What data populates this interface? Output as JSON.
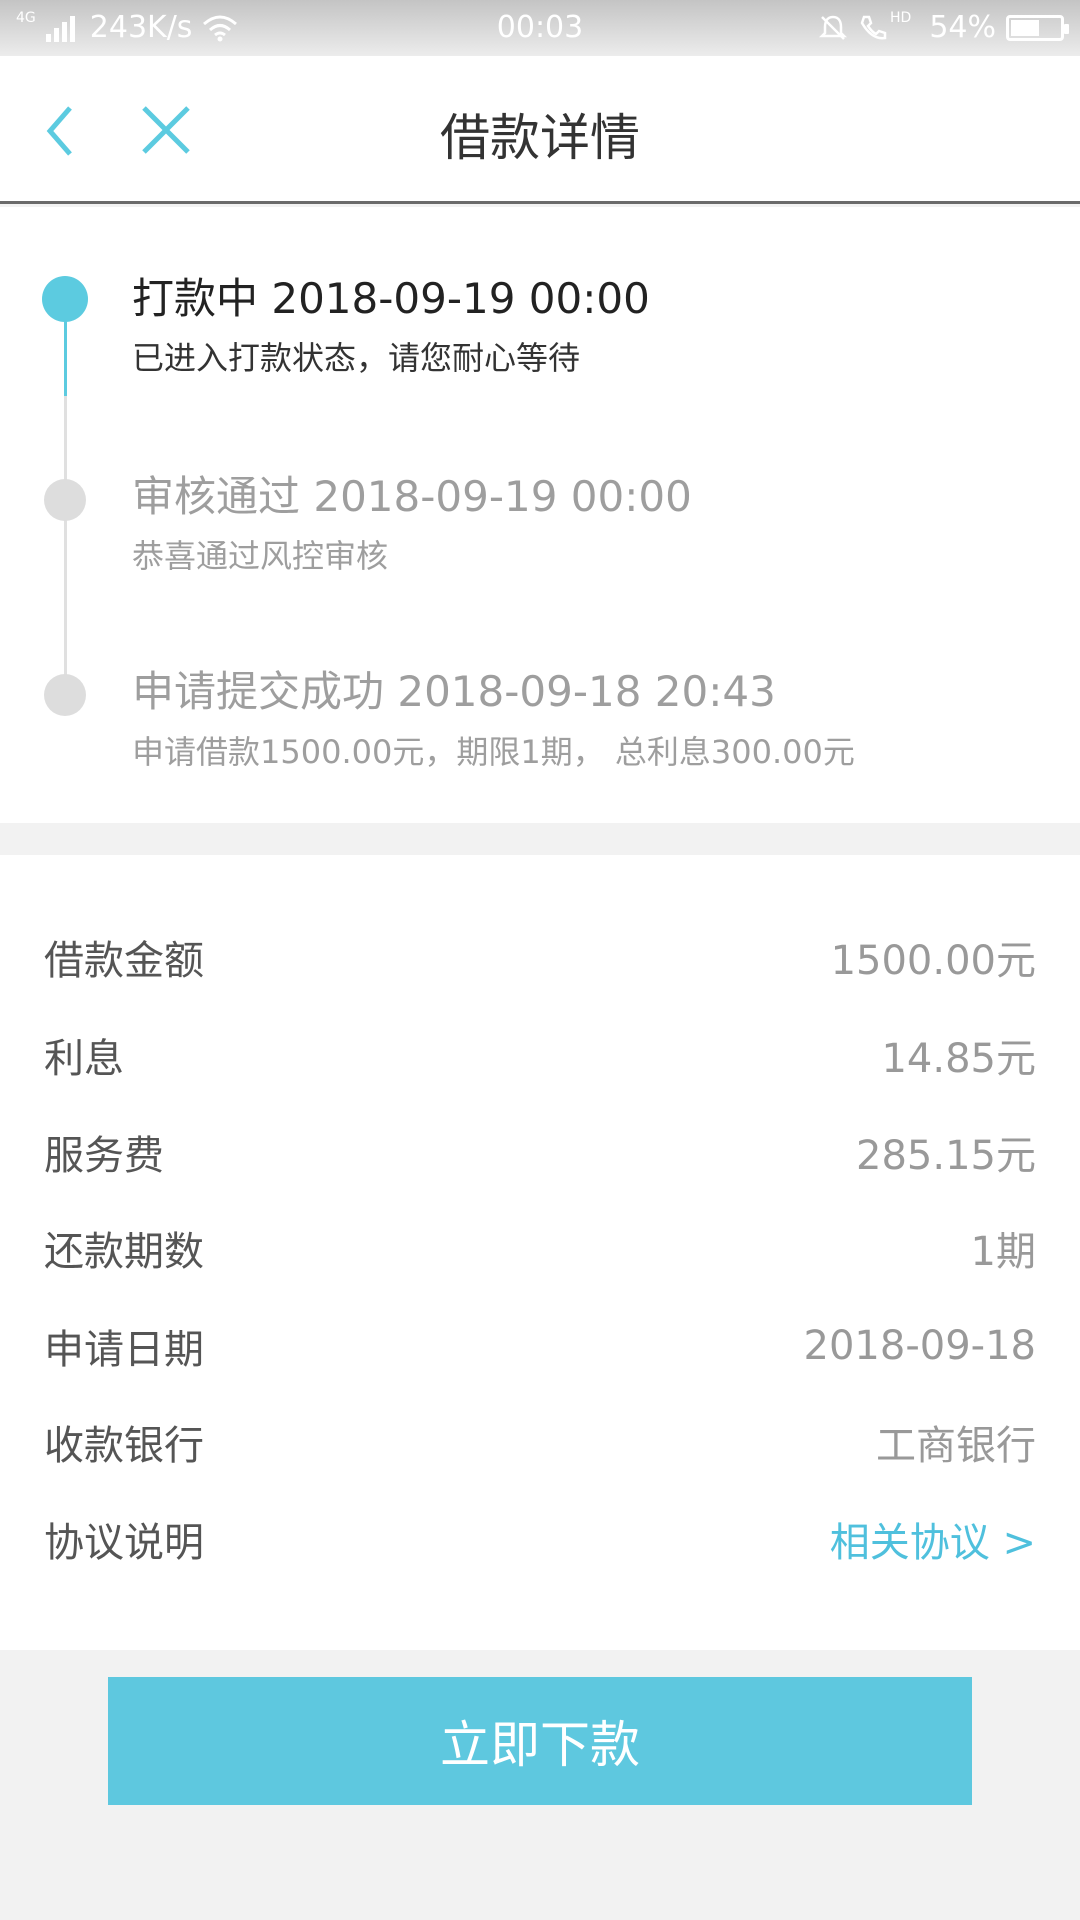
{
  "status_bar": {
    "network_type": "4G",
    "speed": "243K/s",
    "time": "00:03",
    "hd_label": "HD",
    "battery": "54%",
    "battery_level": 0.54,
    "icons": [
      "signal-icon",
      "wifi-icon",
      "mute-bell-icon",
      "hd-call-icon",
      "battery-icon"
    ]
  },
  "nav": {
    "title": "借款详情",
    "back_icon": "chevron-left-icon",
    "close_icon": "close-icon",
    "accent": "#5ccbe0"
  },
  "timeline": [
    {
      "title": "打款中 2018-09-19 00:00",
      "desc": "已进入打款状态，请您耐心等待",
      "state": "active"
    },
    {
      "title": "审核通过 2018-09-19 00:00",
      "desc": "恭喜通过风控审核",
      "state": "done"
    },
    {
      "title": "申请提交成功 2018-09-18 20:43",
      "desc": "申请借款1500.00元，期限1期， 总利息300.00元",
      "state": "done"
    }
  ],
  "details": [
    {
      "label": "借款金额",
      "value": "1500.00元"
    },
    {
      "label": "利息",
      "value": "14.85元"
    },
    {
      "label": "服务费",
      "value": "285.15元"
    },
    {
      "label": "还款期数",
      "value": "1期"
    },
    {
      "label": "申请日期",
      "value": "2018-09-18"
    },
    {
      "label": "收款银行",
      "value": "工商银行"
    },
    {
      "label": "协议说明",
      "link": "相关协议 >"
    }
  ],
  "action": {
    "button_label": "立即下款",
    "color": "#5ec8df"
  }
}
